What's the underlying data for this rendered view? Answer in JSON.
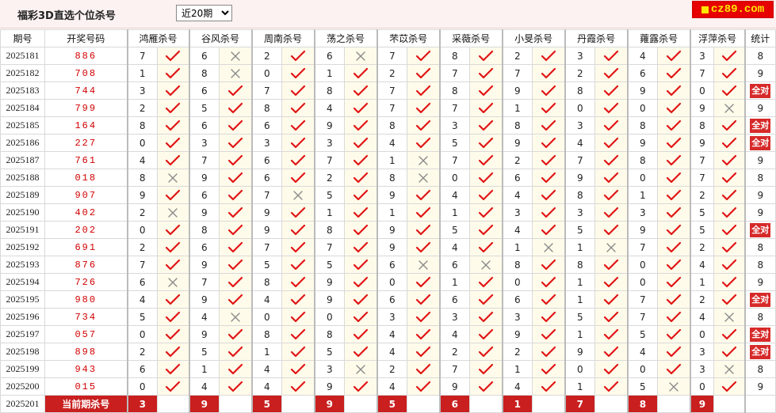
{
  "header": {
    "title": "福彩3D直选个位杀号",
    "range_select": "近20期",
    "brand": "cz89.com"
  },
  "columns": {
    "period": "期号",
    "draw": "开奖号码",
    "experts": [
      "鸿雁杀号",
      "谷风杀号",
      "周南杀号",
      "荡之杀号",
      "芣苡杀号",
      "采薇杀号",
      "小旻杀号",
      "丹霞杀号",
      "蕹露杀号",
      "浮萍杀号"
    ],
    "count": "统计"
  },
  "all_right_label": "全对",
  "rows": [
    {
      "period": "2025181",
      "draw": "886",
      "kills": [
        7,
        6,
        2,
        6,
        7,
        8,
        2,
        3,
        4,
        3
      ],
      "ok": [
        1,
        0,
        1,
        0,
        1,
        1,
        1,
        1,
        1,
        1
      ],
      "count": "8"
    },
    {
      "period": "2025182",
      "draw": "708",
      "kills": [
        1,
        8,
        0,
        1,
        2,
        7,
        7,
        2,
        6,
        7
      ],
      "ok": [
        1,
        0,
        1,
        1,
        1,
        1,
        1,
        1,
        1,
        1
      ],
      "count": "9"
    },
    {
      "period": "2025183",
      "draw": "744",
      "kills": [
        3,
        6,
        7,
        8,
        7,
        8,
        9,
        8,
        9,
        0
      ],
      "ok": [
        1,
        1,
        1,
        1,
        1,
        1,
        1,
        1,
        1,
        1
      ],
      "count": "全对"
    },
    {
      "period": "2025184",
      "draw": "799",
      "kills": [
        2,
        5,
        8,
        4,
        7,
        7,
        1,
        0,
        0,
        9
      ],
      "ok": [
        1,
        1,
        1,
        1,
        1,
        1,
        1,
        1,
        1,
        0
      ],
      "count": "9"
    },
    {
      "period": "2025185",
      "draw": "164",
      "kills": [
        8,
        6,
        6,
        9,
        8,
        3,
        8,
        3,
        8,
        8
      ],
      "ok": [
        1,
        1,
        1,
        1,
        1,
        1,
        1,
        1,
        1,
        1
      ],
      "count": "全对"
    },
    {
      "period": "2025186",
      "draw": "227",
      "kills": [
        0,
        3,
        3,
        3,
        4,
        5,
        9,
        4,
        9,
        9
      ],
      "ok": [
        1,
        1,
        1,
        1,
        1,
        1,
        1,
        1,
        1,
        1
      ],
      "count": "全对"
    },
    {
      "period": "2025187",
      "draw": "761",
      "kills": [
        4,
        7,
        6,
        7,
        1,
        7,
        2,
        7,
        8,
        7
      ],
      "ok": [
        1,
        1,
        1,
        1,
        0,
        1,
        1,
        1,
        1,
        1
      ],
      "count": "9"
    },
    {
      "period": "2025188",
      "draw": "018",
      "kills": [
        8,
        9,
        6,
        2,
        8,
        0,
        6,
        9,
        0,
        7
      ],
      "ok": [
        0,
        1,
        1,
        1,
        0,
        1,
        1,
        1,
        1,
        1
      ],
      "count": "8"
    },
    {
      "period": "2025189",
      "draw": "907",
      "kills": [
        9,
        6,
        7,
        5,
        9,
        4,
        4,
        8,
        1,
        2
      ],
      "ok": [
        1,
        1,
        0,
        1,
        1,
        1,
        1,
        1,
        1,
        1
      ],
      "count": "9"
    },
    {
      "period": "2025190",
      "draw": "402",
      "kills": [
        2,
        9,
        9,
        1,
        1,
        1,
        3,
        3,
        3,
        5
      ],
      "ok": [
        0,
        1,
        1,
        1,
        1,
        1,
        1,
        1,
        1,
        1
      ],
      "count": "9"
    },
    {
      "period": "2025191",
      "draw": "202",
      "kills": [
        0,
        8,
        9,
        8,
        9,
        5,
        4,
        5,
        9,
        5
      ],
      "ok": [
        1,
        1,
        1,
        1,
        1,
        1,
        1,
        1,
        1,
        1
      ],
      "count": "全对"
    },
    {
      "period": "2025192",
      "draw": "691",
      "kills": [
        2,
        6,
        7,
        7,
        9,
        4,
        1,
        1,
        7,
        2
      ],
      "ok": [
        1,
        1,
        1,
        1,
        1,
        1,
        0,
        0,
        1,
        1
      ],
      "count": "8"
    },
    {
      "period": "2025193",
      "draw": "876",
      "kills": [
        7,
        9,
        5,
        5,
        6,
        6,
        8,
        8,
        0,
        4
      ],
      "ok": [
        1,
        1,
        1,
        1,
        0,
        0,
        1,
        1,
        1,
        1
      ],
      "count": "8"
    },
    {
      "period": "2025194",
      "draw": "726",
      "kills": [
        6,
        7,
        8,
        9,
        0,
        1,
        0,
        1,
        0,
        1
      ],
      "ok": [
        0,
        1,
        1,
        1,
        1,
        1,
        1,
        1,
        1,
        1
      ],
      "count": "9"
    },
    {
      "period": "2025195",
      "draw": "980",
      "kills": [
        4,
        9,
        4,
        9,
        6,
        6,
        6,
        1,
        7,
        2
      ],
      "ok": [
        1,
        1,
        1,
        1,
        1,
        1,
        1,
        1,
        1,
        1
      ],
      "count": "全对"
    },
    {
      "period": "2025196",
      "draw": "734",
      "kills": [
        5,
        4,
        0,
        0,
        3,
        3,
        3,
        5,
        7,
        4
      ],
      "ok": [
        1,
        0,
        1,
        1,
        1,
        1,
        1,
        1,
        1,
        0
      ],
      "count": "8"
    },
    {
      "period": "2025197",
      "draw": "057",
      "kills": [
        0,
        9,
        8,
        8,
        4,
        4,
        9,
        1,
        5,
        0
      ],
      "ok": [
        1,
        1,
        1,
        1,
        1,
        1,
        1,
        1,
        1,
        1
      ],
      "count": "全对"
    },
    {
      "period": "2025198",
      "draw": "898",
      "kills": [
        2,
        5,
        1,
        5,
        4,
        2,
        2,
        9,
        4,
        3
      ],
      "ok": [
        1,
        1,
        1,
        1,
        1,
        1,
        1,
        1,
        1,
        1
      ],
      "count": "全对"
    },
    {
      "period": "2025199",
      "draw": "943",
      "kills": [
        6,
        1,
        4,
        3,
        2,
        7,
        1,
        0,
        0,
        3
      ],
      "ok": [
        1,
        1,
        1,
        0,
        1,
        1,
        1,
        1,
        1,
        0
      ],
      "count": "8"
    },
    {
      "period": "2025200",
      "draw": "015",
      "kills": [
        0,
        4,
        4,
        9,
        4,
        9,
        4,
        1,
        5,
        0
      ],
      "ok": [
        1,
        1,
        1,
        1,
        1,
        1,
        1,
        1,
        0,
        1
      ],
      "count": "9"
    }
  ],
  "current": {
    "period": "2025201",
    "label": "当前期杀号",
    "kills": [
      "3",
      "9",
      "5",
      "9",
      "5",
      "6",
      "1",
      "7",
      "8",
      "9"
    ]
  }
}
